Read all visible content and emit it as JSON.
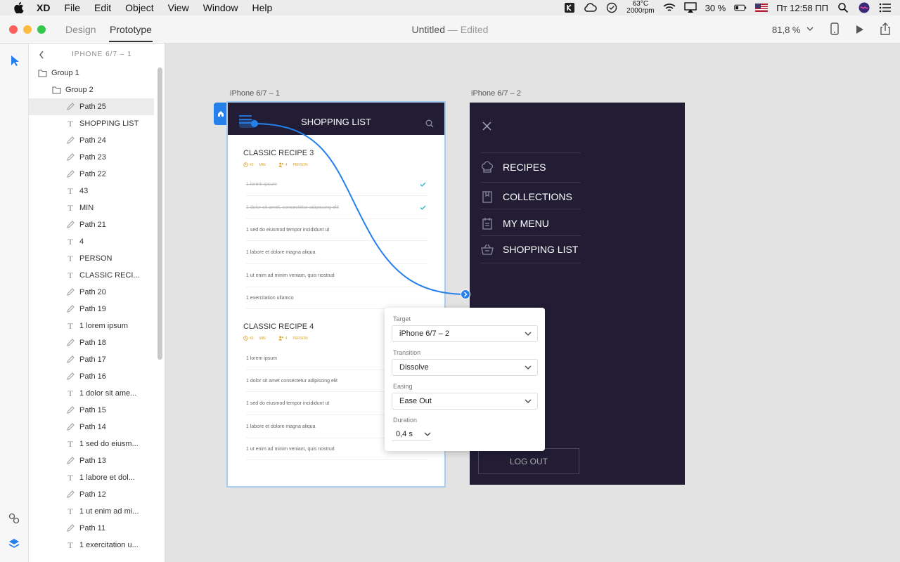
{
  "menubar": {
    "app": "XD",
    "items": [
      "File",
      "Edit",
      "Object",
      "View",
      "Window",
      "Help"
    ],
    "temp": "63°C",
    "rpm": "2000rpm",
    "battery": "30 %",
    "clock": "Пт 12:58 ПП"
  },
  "titlebar": {
    "tab_design": "Design",
    "tab_prototype": "Prototype",
    "doc_name": "Untitled",
    "doc_status": " — Edited",
    "zoom": "81,8 %"
  },
  "layers": {
    "header": "IPHONE 6/7 – 1",
    "items": [
      {
        "label": "Group 1",
        "type": "folder"
      },
      {
        "label": "Group 2",
        "type": "folder"
      },
      {
        "label": "Path 25",
        "type": "path"
      },
      {
        "label": "SHOPPING LIST",
        "type": "text"
      },
      {
        "label": "Path 24",
        "type": "path"
      },
      {
        "label": "Path 23",
        "type": "path"
      },
      {
        "label": "Path 22",
        "type": "path"
      },
      {
        "label": "43",
        "type": "text"
      },
      {
        "label": "MIN",
        "type": "text"
      },
      {
        "label": "Path 21",
        "type": "path"
      },
      {
        "label": "4",
        "type": "text"
      },
      {
        "label": "PERSON",
        "type": "text"
      },
      {
        "label": "CLASSIC RECI...",
        "type": "text"
      },
      {
        "label": "Path 20",
        "type": "path"
      },
      {
        "label": "Path 19",
        "type": "path"
      },
      {
        "label": "1 lorem ipsum",
        "type": "text"
      },
      {
        "label": "Path 18",
        "type": "path"
      },
      {
        "label": "Path 17",
        "type": "path"
      },
      {
        "label": "Path 16",
        "type": "path"
      },
      {
        "label": "1 dolor sit ame...",
        "type": "text"
      },
      {
        "label": "Path 15",
        "type": "path"
      },
      {
        "label": "Path 14",
        "type": "path"
      },
      {
        "label": "1 sed do eiusm...",
        "type": "text"
      },
      {
        "label": "Path 13",
        "type": "path"
      },
      {
        "label": "1 labore et dol...",
        "type": "text"
      },
      {
        "label": "Path 12",
        "type": "path"
      },
      {
        "label": "1 ut enim ad mi...",
        "type": "text"
      },
      {
        "label": "Path 11",
        "type": "path"
      },
      {
        "label": "1 exercitation u...",
        "type": "text"
      }
    ]
  },
  "artboard1": {
    "label": "iPhone 6/7 – 1",
    "title": "SHOPPING LIST",
    "recipes": [
      {
        "title": "CLASSIC RECIPE 3",
        "minutes": "43",
        "min_unit": "MIN",
        "persons": "4",
        "person_unit": "PERSON",
        "items": [
          {
            "text": "1 lorem ipsum",
            "done": true
          },
          {
            "text": "1 dolor sit amet, consectetur adipiscing elit",
            "done": true
          },
          {
            "text": "1 sed do eiusmod tempor incididunt ut",
            "done": false
          },
          {
            "text": "1 labore et dolore magna aliqua",
            "done": false
          },
          {
            "text": "1 ut enim ad minim veniam, quis nostrud",
            "done": false
          },
          {
            "text": "1 exercitation ullamco",
            "done": false
          }
        ]
      },
      {
        "title": "CLASSIC RECIPE 4",
        "minutes": "43",
        "min_unit": "MIN",
        "persons": "4",
        "person_unit": "PERSON",
        "items": [
          {
            "text": "1 lorem ipsum",
            "done": false
          },
          {
            "text": "1 dolor sit amet consectetur adipiscing elit",
            "done": false
          },
          {
            "text": "1 sed do eiusmod tempor incididunt ut",
            "done": false
          },
          {
            "text": "1 labore et dolore magna aliqua",
            "done": false
          },
          {
            "text": "1 ut enim ad minim veniam, quis nostrud",
            "done": false
          }
        ]
      }
    ]
  },
  "artboard2": {
    "label": "iPhone 6/7 – 2",
    "menu": [
      {
        "label": "RECIPES",
        "icon": "chef-hat-icon"
      },
      {
        "label": "COLLECTIONS",
        "icon": "bookmark-book-icon"
      },
      {
        "label": "MY MENU",
        "icon": "notepad-icon"
      },
      {
        "label": "SHOPPING LIST",
        "icon": "basket-icon"
      }
    ],
    "logout": "LOG OUT"
  },
  "popover": {
    "target_label": "Target",
    "target_value": "iPhone 6/7 – 2",
    "transition_label": "Transition",
    "transition_value": "Dissolve",
    "easing_label": "Easing",
    "easing_value": "Ease Out",
    "duration_label": "Duration",
    "duration_value": "0,4 s"
  },
  "colors": {
    "accent": "#2680eb",
    "dark_bg": "#221d35",
    "check": "#2bb5c9",
    "meta": "#e0a31a"
  }
}
